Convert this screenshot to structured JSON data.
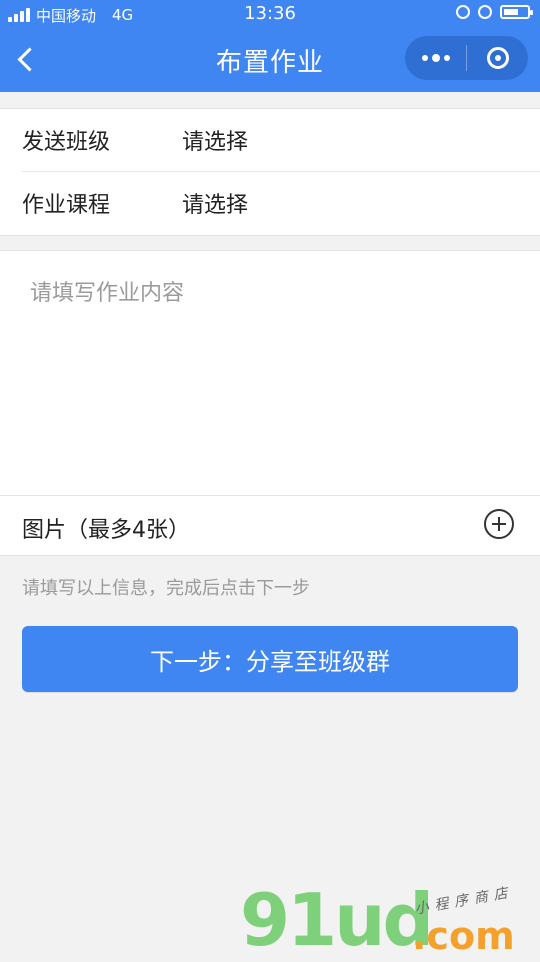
{
  "status": {
    "carrier": "中国移动",
    "network": "4G",
    "time": "13:36"
  },
  "nav": {
    "title": "布置作业"
  },
  "form": {
    "class_label": "发送班级",
    "class_value": "请选择",
    "course_label": "作业课程",
    "course_value": "请选择",
    "content_placeholder": "请填写作业内容",
    "images_label": "图片（最多4张）"
  },
  "footer": {
    "hint": "请填写以上信息，完成后点击下一步",
    "next_button": "下一步：分享至班级群"
  },
  "watermark": {
    "main": "91ud",
    "domain": ".com",
    "tagline": "小程序商店"
  },
  "colors": {
    "primary": "#3f86f3",
    "background": "#f2f2f2"
  },
  "icons": [
    "back-arrow-icon",
    "more-dots-icon",
    "close-target-icon",
    "add-circle-icon"
  ]
}
